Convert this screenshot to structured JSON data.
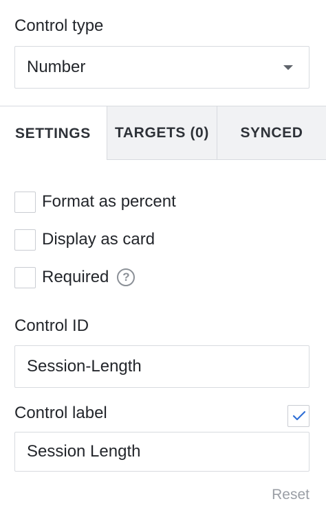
{
  "control_type": {
    "label": "Control type",
    "selected": "Number"
  },
  "tabs": [
    {
      "label": "SETTINGS",
      "active": true
    },
    {
      "label": "TARGETS (0)",
      "active": false
    },
    {
      "label": "SYNCED",
      "active": false
    }
  ],
  "options": [
    {
      "label": "Format as percent",
      "checked": false
    },
    {
      "label": "Display as card",
      "checked": false
    },
    {
      "label": "Required",
      "checked": false
    }
  ],
  "help_icon_glyph": "?",
  "control_id": {
    "label": "Control ID",
    "value": "Session-Length"
  },
  "control_label": {
    "label": "Control label",
    "value": "Session Length",
    "checked": true
  },
  "reset_label": "Reset",
  "colors": {
    "accent": "#2f6fd6",
    "border": "#d7dadf",
    "tab_inactive_bg": "#f1f2f4",
    "muted_text": "#9a9ea5"
  }
}
